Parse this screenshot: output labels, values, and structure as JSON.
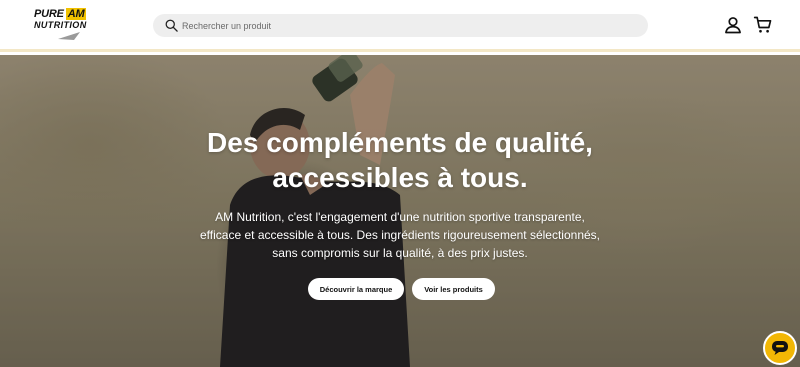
{
  "header": {
    "logo": {
      "line1": "PURE",
      "badge": "AM",
      "line2": "NUTRITION"
    },
    "search": {
      "placeholder": "Rechercher un produit"
    },
    "icons": {
      "account": "account-icon",
      "cart": "cart-icon",
      "search": "search-icon"
    }
  },
  "hero": {
    "title": "Des compléments de qualité, accessibles à tous.",
    "text": "AM Nutrition, c'est l'engagement d'une nutrition sportive transparente, efficace et accessible à tous. Des ingrédients rigoureusement sélectionnés, sans compromis sur la qualité, à des prix justes.",
    "buttons": {
      "brand": "Découvrir la marque",
      "products": "Voir les produits"
    }
  },
  "chat": {
    "icon": "chat-icon"
  },
  "colors": {
    "accent": "#f2b705",
    "header_border": "#f3e7c6",
    "search_bg": "#eeeeee"
  }
}
